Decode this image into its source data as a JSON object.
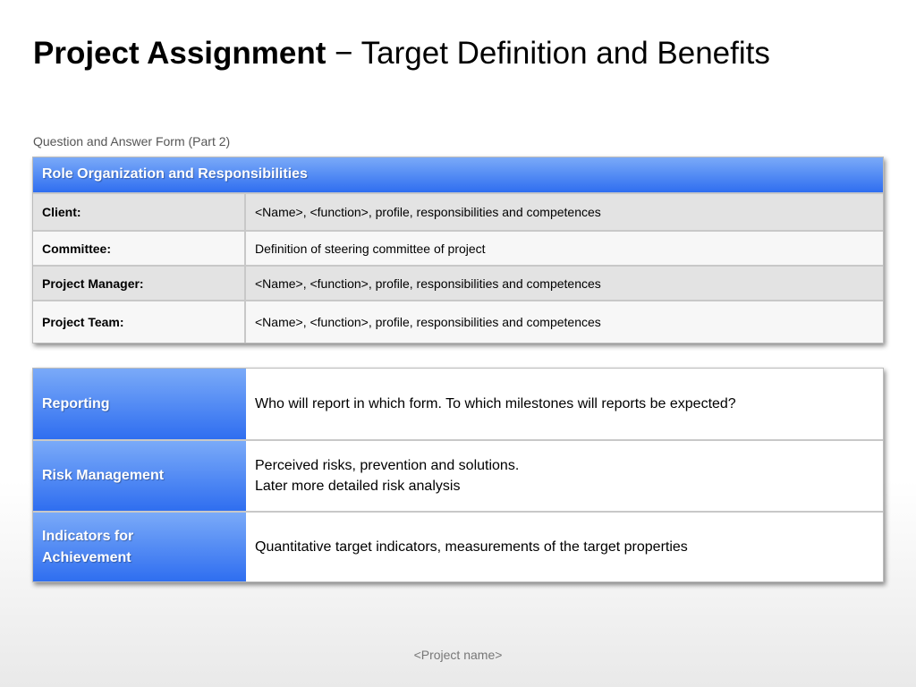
{
  "title": {
    "bold": "Project Assignment",
    "rest": " − Target Definition and Benefits"
  },
  "subtitle": "Question and Answer Form (Part 2)",
  "roles": {
    "header": "Role Organization and Responsibilities",
    "rows": [
      {
        "label": "Client:",
        "value": "<Name>, <function>, profile, responsibilities and competences"
      },
      {
        "label": "Committee:",
        "value": "Definition of steering committee of project"
      },
      {
        "label": "Project Manager:",
        "value": "<Name>, <function>, profile, responsibilities and competences"
      },
      {
        "label": "Project Team:",
        "value": "<Name>, <function>, profile, responsibilities and competences"
      }
    ]
  },
  "details": [
    {
      "label": "Reporting",
      "lines": [
        "Who will report in which form. To which milestones will reports be expected?"
      ]
    },
    {
      "label": "Risk Management",
      "lines": [
        "Perceived risks, prevention and solutions.",
        "Later more detailed risk analysis"
      ]
    },
    {
      "label": "Indicators for Achievement",
      "lines": [
        "Quantitative target indicators, measurements of the target properties"
      ]
    }
  ],
  "footer": "<Project name>"
}
